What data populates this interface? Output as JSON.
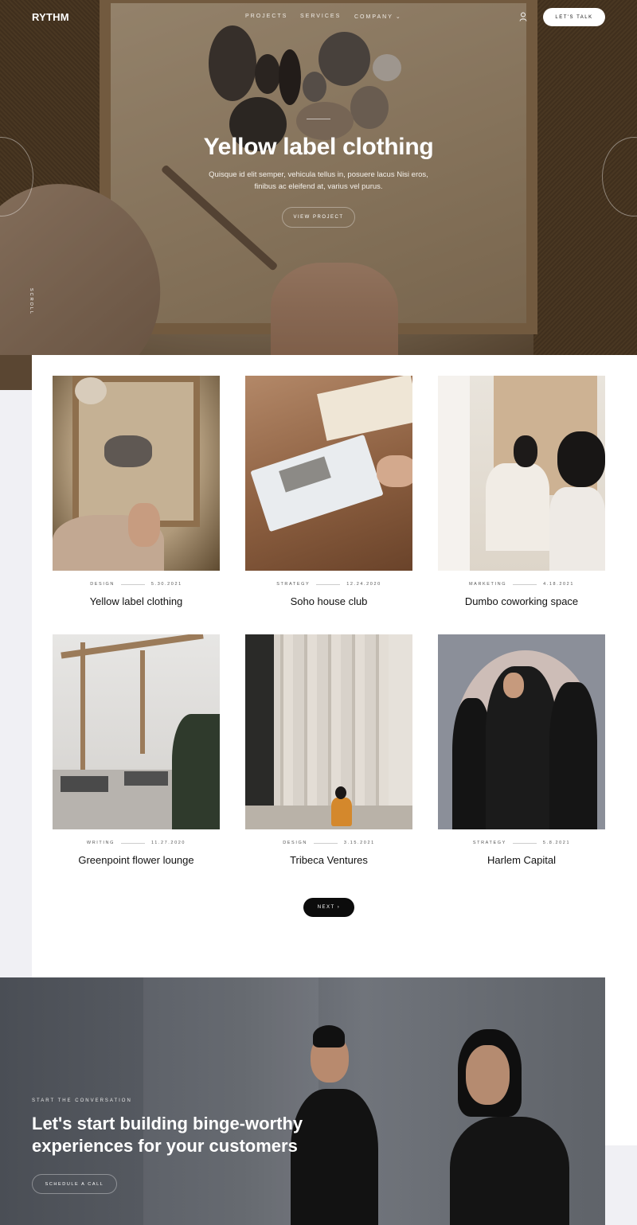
{
  "brand": {
    "logo": "RYTHM"
  },
  "nav": {
    "items": [
      "PROJECTS",
      "SERVICES",
      "COMPANY"
    ],
    "company_chevron": "⌄",
    "cta_label": "LET'S TALK"
  },
  "hero": {
    "title": "Yellow label clothing",
    "subtitle": "Quisque id elit semper, vehicula tellus in, posuere lacus Nisi eros, finibus ac eleifend at, varius vel purus.",
    "button_label": "VIEW PROJECT",
    "scroll_label": "SCROLL"
  },
  "projects": [
    {
      "category": "DESIGN",
      "date": "5.30.2021",
      "title": "Yellow label clothing"
    },
    {
      "category": "STRATEGY",
      "date": "12.24.2020",
      "title": "Soho house club"
    },
    {
      "category": "MARKETING",
      "date": "4.18.2021",
      "title": "Dumbo coworking space"
    },
    {
      "category": "WRITING",
      "date": "11.27.2020",
      "title": "Greenpoint flower lounge"
    },
    {
      "category": "DESIGN",
      "date": "3.15.2021",
      "title": "Tribeca Ventures"
    },
    {
      "category": "STRATEGY",
      "date": "5.8.2021",
      "title": "Harlem Capital"
    }
  ],
  "pagination": {
    "next_label": "NEXT ›"
  },
  "cta": {
    "kicker": "START THE CONVERSATION",
    "title": "Let's start building binge-worthy experiences for your customers",
    "button_label": "SCHEDULE A CALL"
  }
}
